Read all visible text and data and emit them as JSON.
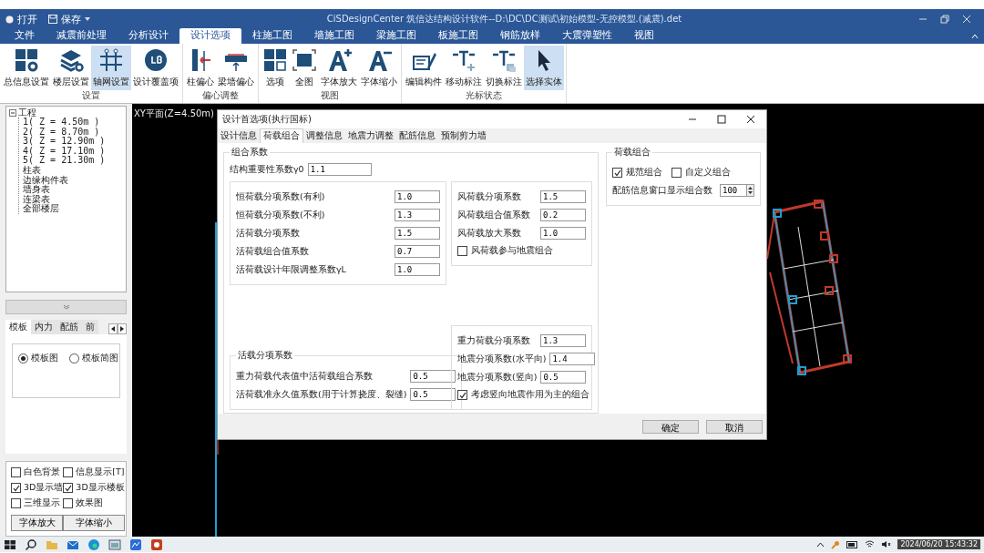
{
  "window": {
    "title": "CiSDesignCenter 筑信达结构设计软件--D:\\DC\\DC测试\\初始模型-无控模型.(减震).det",
    "quick_access": [
      "打开",
      "保存"
    ]
  },
  "menu_tabs": [
    {
      "label": "文件",
      "selected": false
    },
    {
      "label": "减震前处理",
      "selected": false
    },
    {
      "label": "分析设计",
      "selected": false
    },
    {
      "label": "设计选项",
      "selected": true
    },
    {
      "label": "柱施工图",
      "selected": false
    },
    {
      "label": "墙施工图",
      "selected": false
    },
    {
      "label": "梁施工图",
      "selected": false
    },
    {
      "label": "板施工图",
      "selected": false
    },
    {
      "label": "钢筋放样",
      "selected": false
    },
    {
      "label": "大震弹塑性",
      "selected": false
    },
    {
      "label": "视图",
      "selected": false
    }
  ],
  "ribbon_groups": [
    {
      "title": "设置",
      "buttons": [
        {
          "label": "总信息设置",
          "selected": false
        },
        {
          "label": "楼层设置",
          "selected": false
        },
        {
          "label": "轴网设置",
          "selected": true
        },
        {
          "label": "设计覆盖项",
          "selected": false
        }
      ]
    },
    {
      "title": "偏心调整",
      "buttons": [
        {
          "label": "柱偏心",
          "selected": false
        },
        {
          "label": "梁墙偏心",
          "selected": false
        }
      ]
    },
    {
      "title": "视图",
      "buttons": [
        {
          "label": "选项",
          "selected": false
        },
        {
          "label": "全图",
          "selected": false
        },
        {
          "label": "字体放大",
          "selected": false
        },
        {
          "label": "字体缩小",
          "selected": false
        }
      ]
    },
    {
      "title": "光标状态",
      "buttons": [
        {
          "label": "编辑构件",
          "selected": false
        },
        {
          "label": "移动标注",
          "selected": false
        },
        {
          "label": "切换标注",
          "selected": false
        },
        {
          "label": "选择实体",
          "selected": true
        }
      ]
    }
  ],
  "tree": [
    {
      "label": "工程",
      "expanded": true,
      "children": [
        {
          "label": "1( Z = 4.50m )"
        },
        {
          "label": "2( Z = 8.70m )"
        },
        {
          "label": "3( Z = 12.90m )"
        },
        {
          "label": "4( Z = 17.10m )"
        },
        {
          "label": "5( Z = 21.30m )"
        },
        {
          "label": "柱表"
        },
        {
          "label": "边缘构件表"
        },
        {
          "label": "墙身表"
        },
        {
          "label": "连梁表"
        },
        {
          "label": "全部楼层"
        }
      ]
    }
  ],
  "panel_tabs": [
    {
      "label": "模板",
      "selected": true
    },
    {
      "label": "内力",
      "selected": false
    },
    {
      "label": "配筋",
      "selected": false
    },
    {
      "label": "前",
      "selected": false
    }
  ],
  "drawing_options": [
    {
      "label": "模板图",
      "selected": true
    },
    {
      "label": "模板简图",
      "selected": false
    }
  ],
  "display_options": [
    {
      "label": "白色背景",
      "checked": false
    },
    {
      "label": "信息显示[T]",
      "checked": false
    },
    {
      "label": "3D显示墙",
      "checked": true
    },
    {
      "label": "3D显示楼板",
      "checked": true
    },
    {
      "label": "三维显示",
      "checked": false
    },
    {
      "label": "效果图",
      "checked": false
    }
  ],
  "panel_buttons": [
    "字体放大",
    "字体缩小"
  ],
  "canvas": {
    "view_label": "XY平面(Z=4.50m)"
  },
  "dialog": {
    "title": "设计首选项(执行国标)",
    "tabs": [
      {
        "label": "设计信息",
        "selected": false
      },
      {
        "label": "荷载组合",
        "selected": true
      },
      {
        "label": "调整信息",
        "selected": false
      },
      {
        "label": "地震力调整",
        "selected": false
      },
      {
        "label": "配筋信息",
        "selected": false
      },
      {
        "label": "预制剪力墙",
        "selected": false
      }
    ],
    "combination_group": {
      "title": "组合系数",
      "importance": {
        "label": "结构重要性系数γ0",
        "value": "1.1"
      },
      "dead_live": [
        {
          "label": "恒荷载分项系数(有利)",
          "value": "1.0"
        },
        {
          "label": "恒荷载分项系数(不利)",
          "value": "1.3"
        },
        {
          "label": "活荷载分项系数",
          "value": "1.5"
        },
        {
          "label": "活荷载组合值系数",
          "value": "0.7"
        },
        {
          "label": "活荷载设计年限调整系数γL",
          "value": "1.0"
        }
      ],
      "wind": [
        {
          "label": "风荷载分项系数",
          "value": "1.5"
        },
        {
          "label": "风荷载组合值系数",
          "value": "0.2"
        },
        {
          "label": "风荷载放大系数",
          "value": "1.0"
        }
      ],
      "wind_check": {
        "label": "风荷载参与地震组合",
        "checked": false
      },
      "live_group": {
        "title": "活载分项系数",
        "fields": [
          {
            "label": "重力荷载代表值中活荷载组合系数",
            "value": "0.5"
          },
          {
            "label": "活荷载准永久值系数(用于计算挠度、裂缝)",
            "value": "0.5"
          }
        ]
      },
      "seismic": [
        {
          "label": "重力荷载分项系数",
          "value": "1.3"
        },
        {
          "label": "地震分项系数(水平向)",
          "value": "1.4"
        },
        {
          "label": "地震分项系数(竖向)",
          "value": "0.5"
        }
      ],
      "seismic_check": {
        "label": "考虑竖向地震作用为主的组合",
        "checked": true
      }
    },
    "load_group": {
      "title": "荷载组合",
      "checks": [
        {
          "label": "规范组合",
          "checked": true
        },
        {
          "label": "自定义组合",
          "checked": false
        }
      ],
      "count": {
        "label": "配筋信息窗口显示组合数",
        "value": "100"
      }
    },
    "buttons": [
      "确定",
      "取消"
    ]
  },
  "taskbar": {
    "clock": "2024/06/20 15:43:32"
  }
}
